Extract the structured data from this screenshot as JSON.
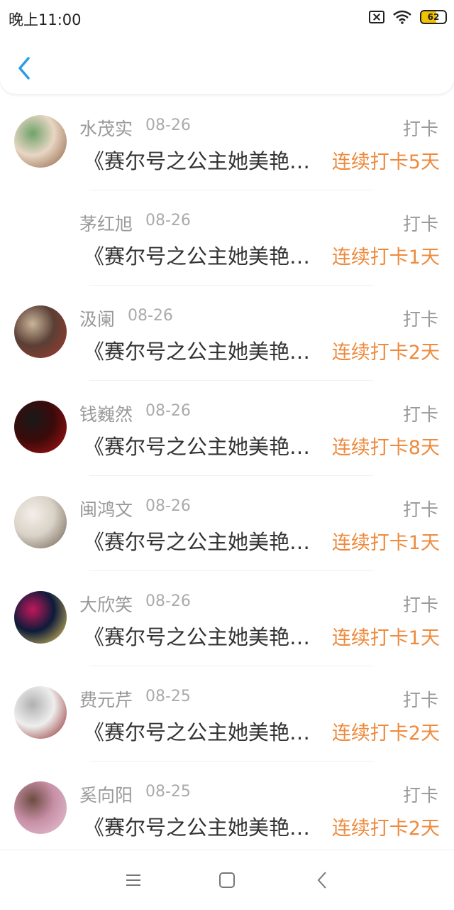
{
  "status": {
    "time": "晚上11:00",
    "battery": "62",
    "battery_level": 0.62
  },
  "list": [
    {
      "name": "水茂实",
      "date": "08-26",
      "type": "打卡",
      "title": "《赛尔号之公主她美艳…",
      "streak": "连续打卡5天",
      "avatar_colors": [
        "#e8d6c4",
        "#8a5a3a",
        "#6fa36a"
      ]
    },
    {
      "name": "茅红旭",
      "date": "08-26",
      "type": "打卡",
      "title": "《赛尔号之公主她美艳…",
      "streak": "连续打卡1天",
      "avatar_colors": []
    },
    {
      "name": "汲阑",
      "date": "08-26",
      "type": "打卡",
      "title": "《赛尔号之公主她美艳…",
      "streak": "连续打卡2天",
      "avatar_colors": [
        "#5a3f35",
        "#a33b2e",
        "#c9b59a"
      ]
    },
    {
      "name": "钱巍然",
      "date": "08-26",
      "type": "打卡",
      "title": "《赛尔号之公主她美艳…",
      "streak": "连续打卡8天",
      "avatar_colors": [
        "#3b0a0a",
        "#b21414",
        "#1a1a1a"
      ]
    },
    {
      "name": "闽鸿文",
      "date": "08-26",
      "type": "打卡",
      "title": "《赛尔号之公主她美艳…",
      "streak": "连续打卡1天",
      "avatar_colors": [
        "#d9d2c7",
        "#6b5b4c",
        "#f3efe9"
      ]
    },
    {
      "name": "大欣笑",
      "date": "08-26",
      "type": "打卡",
      "title": "《赛尔号之公主她美艳…",
      "streak": "连续打卡1天",
      "avatar_colors": [
        "#0d1b3a",
        "#f4d35e",
        "#c2185b"
      ]
    },
    {
      "name": "费元芹",
      "date": "08-25",
      "type": "打卡",
      "title": "《赛尔号之公主她美艳…",
      "streak": "连续打卡2天",
      "avatar_colors": [
        "#eeeeee",
        "#8b1e1e",
        "#b0b0b0"
      ]
    },
    {
      "name": "奚向阳",
      "date": "08-25",
      "type": "打卡",
      "title": "《赛尔号之公主她美艳…",
      "streak": "连续打卡2天",
      "avatar_colors": [
        "#c78fa6",
        "#e7c6d3",
        "#6d4c41"
      ]
    }
  ]
}
